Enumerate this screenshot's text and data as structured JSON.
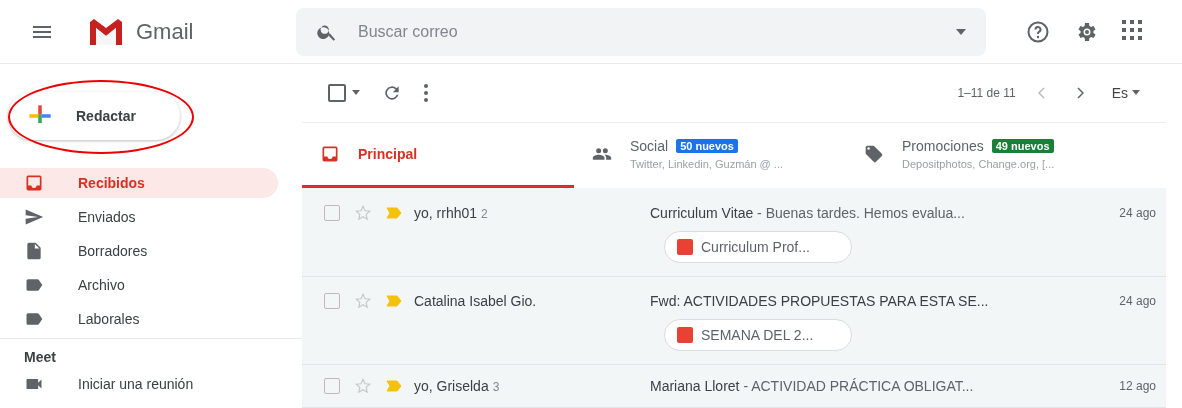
{
  "header": {
    "app_name": "Gmail",
    "search": {
      "placeholder": "Buscar correo"
    }
  },
  "sidebar": {
    "compose": {
      "label": "Redactar",
      "highlighted": true
    },
    "items": [
      {
        "label": "Recibidos",
        "selected": true
      },
      {
        "label": "Enviados",
        "selected": false
      },
      {
        "label": "Borradores",
        "selected": false
      },
      {
        "label": "Archivo",
        "selected": false
      },
      {
        "label": "Laborales",
        "selected": false
      }
    ],
    "meet": {
      "title": "Meet",
      "items": [
        {
          "label": "Iniciar una reunión"
        }
      ]
    }
  },
  "toolbar": {
    "select_all_checked": false,
    "pagination": "1–11 de 11",
    "language": "Es"
  },
  "tabs": [
    {
      "label": "Principal",
      "selected": true
    },
    {
      "label": "Social",
      "selected": false,
      "badge": "50 nuevos",
      "color": "#1a73e8",
      "subtitle": "Twitter, Linkedin, Guzmán @ ..."
    },
    {
      "label": "Promociones",
      "selected": false,
      "badge": "49 nuevos",
      "color": "#188038",
      "subtitle": "Depositphotos, Change.org, [..."
    }
  ],
  "emails": [
    {
      "sender": "yo, rrhh01",
      "count": "2",
      "subject": "Curriculum Vitae",
      "snippet": " - Buenas tardes. Hemos evalua...",
      "date": "24 ago",
      "starred": false,
      "important": true,
      "read": true,
      "attachment": "Curriculum Prof..."
    },
    {
      "sender": "Catalina Isabel Gio.",
      "subject": "Fwd: ACTIVIDADES PROPUESTAS PARA ESTA SE...",
      "date": "24 ago",
      "starred": false,
      "important": true,
      "read": true,
      "attachment": "SEMANA DEL 2..."
    },
    {
      "sender": "yo, Griselda",
      "count": "3",
      "subject": "Mariana Lloret",
      "snippet": " - ACTIVIDAD PRÁCTICA OBLIGAT...",
      "date": "12 ago",
      "starred": false,
      "important": true,
      "read": true
    }
  ]
}
